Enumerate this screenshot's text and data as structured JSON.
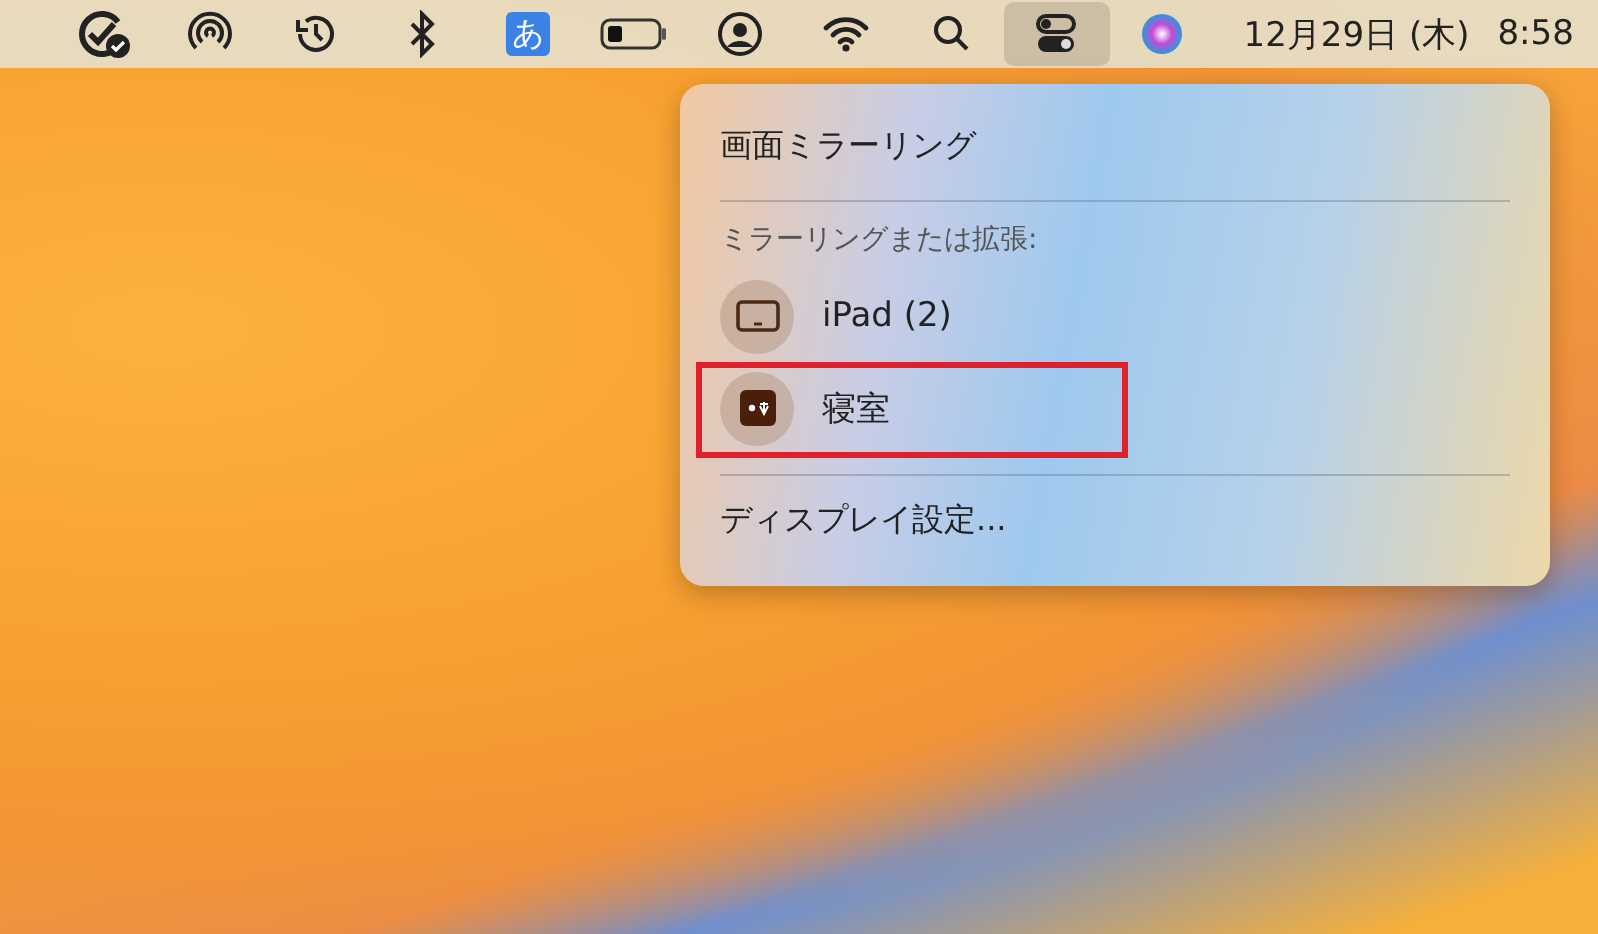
{
  "menu_bar": {
    "items": [
      {
        "kind": "checkbadge",
        "selected": false
      },
      {
        "kind": "airdrop",
        "selected": false
      },
      {
        "kind": "timemachine",
        "selected": false
      },
      {
        "kind": "bluetooth",
        "selected": false
      },
      {
        "kind": "input",
        "label": "あ",
        "selected": false
      },
      {
        "kind": "battery",
        "selected": false
      },
      {
        "kind": "user",
        "selected": false
      },
      {
        "kind": "wifi",
        "selected": false
      },
      {
        "kind": "search",
        "selected": false
      },
      {
        "kind": "controlcenter",
        "selected": true
      },
      {
        "kind": "siri",
        "selected": false
      }
    ],
    "date": "12月29日 (木)",
    "time": "8:58"
  },
  "popup": {
    "title": "画面ミラーリング",
    "section": "ミラーリングまたは拡張:",
    "devices": [
      {
        "kind": "ipad",
        "name": "iPad (2)",
        "annotated": false
      },
      {
        "kind": "appletv",
        "name": "寝室",
        "annotated": true
      }
    ],
    "footer": "ディスプレイ設定..."
  }
}
